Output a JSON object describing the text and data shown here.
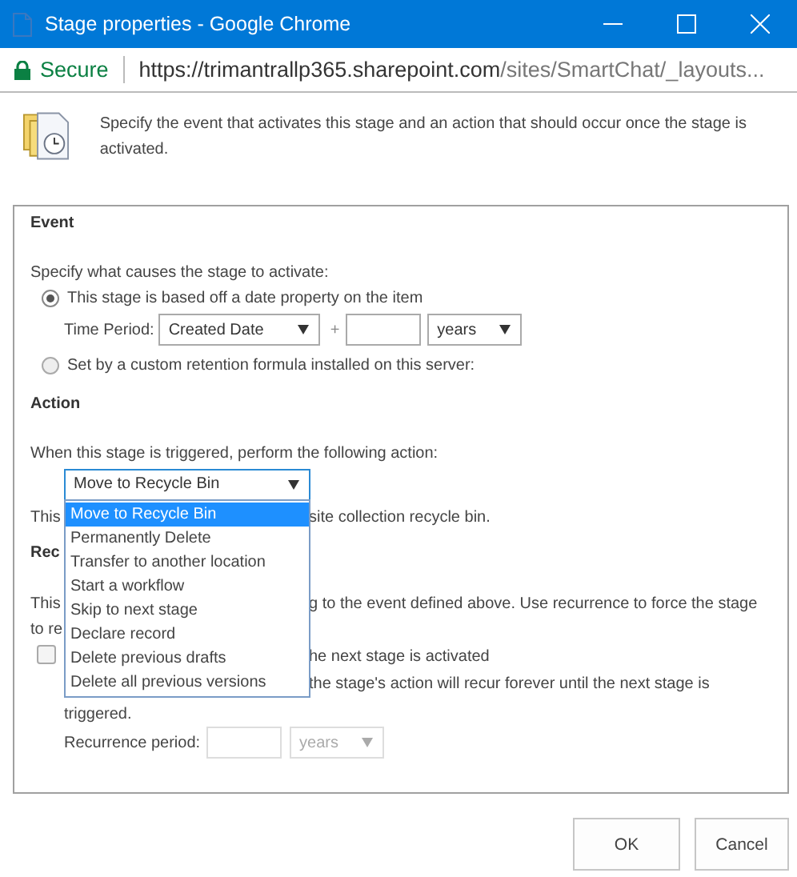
{
  "window": {
    "title": "Stage properties - Google Chrome"
  },
  "address_bar": {
    "security": "Secure",
    "url_host": "https://trimantrallp365.sharepoint.com",
    "url_path": "/sites/SmartChat/_layouts..."
  },
  "intro": "Specify the event that activates this stage and an action that should occur once the stage is activated.",
  "event": {
    "heading": "Event",
    "prompt": "Specify what causes the stage to activate:",
    "options": [
      {
        "label": "This stage is based off a date property on the item",
        "selected": true
      },
      {
        "label": "Set by a custom retention formula installed on this server:",
        "selected": false
      }
    ],
    "time_period": {
      "label": "Time Period:",
      "date_field": "Created Date",
      "plus": "+",
      "unit": "years"
    }
  },
  "action": {
    "heading": "Action",
    "prompt": "When this stage is triggered, perform the following action:",
    "value": "Move to Recycle Bin",
    "expanded": true,
    "options": [
      {
        "label": "Move to Recycle Bin",
        "selected": true
      },
      {
        "label": "Permanently Delete",
        "selected": false
      },
      {
        "label": "Transfer to another location",
        "selected": false
      },
      {
        "label": "Start a workflow",
        "selected": false
      },
      {
        "label": "Skip to next stage",
        "selected": false
      },
      {
        "label": "Declare record",
        "selected": false
      },
      {
        "label": "Delete previous drafts",
        "selected": false
      },
      {
        "label": "Delete all previous versions",
        "selected": false
      }
    ],
    "description_parts": [
      "This",
      "site collection recycle bin."
    ]
  },
  "recurrence": {
    "heading": "Rec",
    "description_parts": [
      "This",
      "g to the event defined above. Use recurrence to force the stage",
      "to re"
    ],
    "checkbox": {
      "label": "he next stage is activated",
      "checked": false
    },
    "note_parts": [
      "the stage's action will recur forever until the next stage is",
      "triggered."
    ],
    "period_label": "Recurrence period:",
    "unit": "years",
    "disabled": true
  },
  "buttons": [
    {
      "label": "OK"
    },
    {
      "label": "Cancel"
    }
  ]
}
